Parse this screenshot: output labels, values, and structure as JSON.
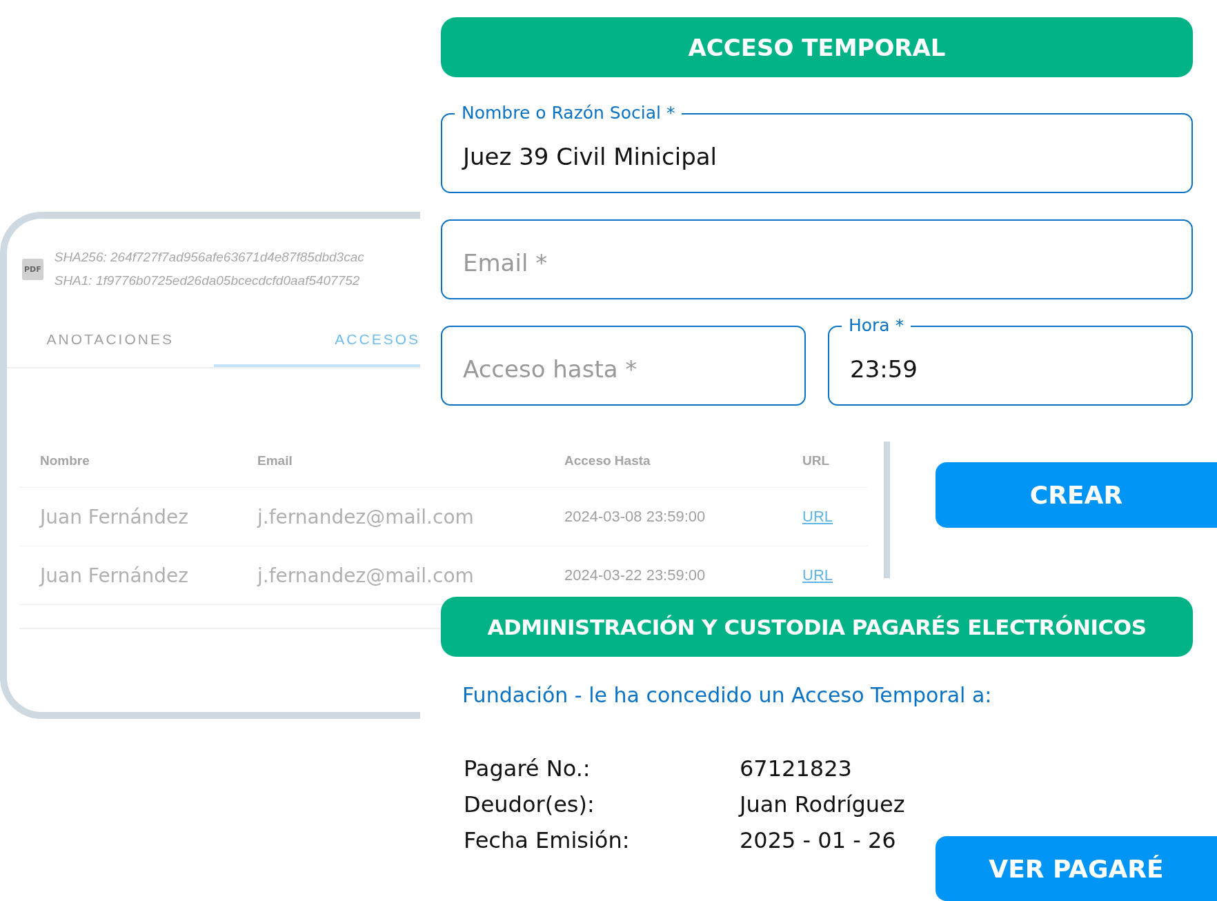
{
  "document_card": {
    "file_type": "PDF",
    "hashes": [
      "SHA256: 264f727f7ad956afe63671d4e87f85dbd3cac",
      "SHA1: 1f9776b0725ed26da05bcecdcfd0aaf5407752"
    ],
    "tabs": [
      {
        "label": "ANOTACIONES",
        "selected": false
      },
      {
        "label": "ACCESOS",
        "selected": true
      }
    ]
  },
  "access_table": {
    "columns": [
      "Nombre",
      "Email",
      "Acceso Hasta",
      "URL"
    ],
    "rows": [
      {
        "name": "Juan Fernández",
        "email": "j.fernandez@mail.com",
        "until": "2024-03-08 23:59:00",
        "url": "URL"
      },
      {
        "name": "Juan Fernández",
        "email": "j.fernandez@mail.com",
        "until": "2024-03-22 23:59:00",
        "url": "URL"
      }
    ]
  },
  "temporary_access_form": {
    "title": "ACCESO TEMPORAL",
    "fields": [
      {
        "label": "Nombre o Razón Social *",
        "value": "Juez 39 Civil Minicipal"
      },
      {
        "placeholder": "Email *"
      },
      {
        "placeholder": "Acceso hasta *"
      },
      {
        "label": "Hora *",
        "value": "23:59"
      }
    ],
    "button": "CREAR"
  },
  "notice": {
    "title": "ADMINISTRACIÓN Y CUSTODIA PAGARÉS ELECTRÓNICOS",
    "message": "Fundación - le ha concedido un Acceso Temporal a:",
    "details": [
      {
        "label": "Pagaré No.:",
        "value": "67121823"
      },
      {
        "label": "Deudor(es):",
        "value": "Juan Rodríguez"
      },
      {
        "label": "Fecha Emisión:",
        "value": "2025 - 01 - 26"
      }
    ],
    "button": "VER PAGARÉ"
  }
}
